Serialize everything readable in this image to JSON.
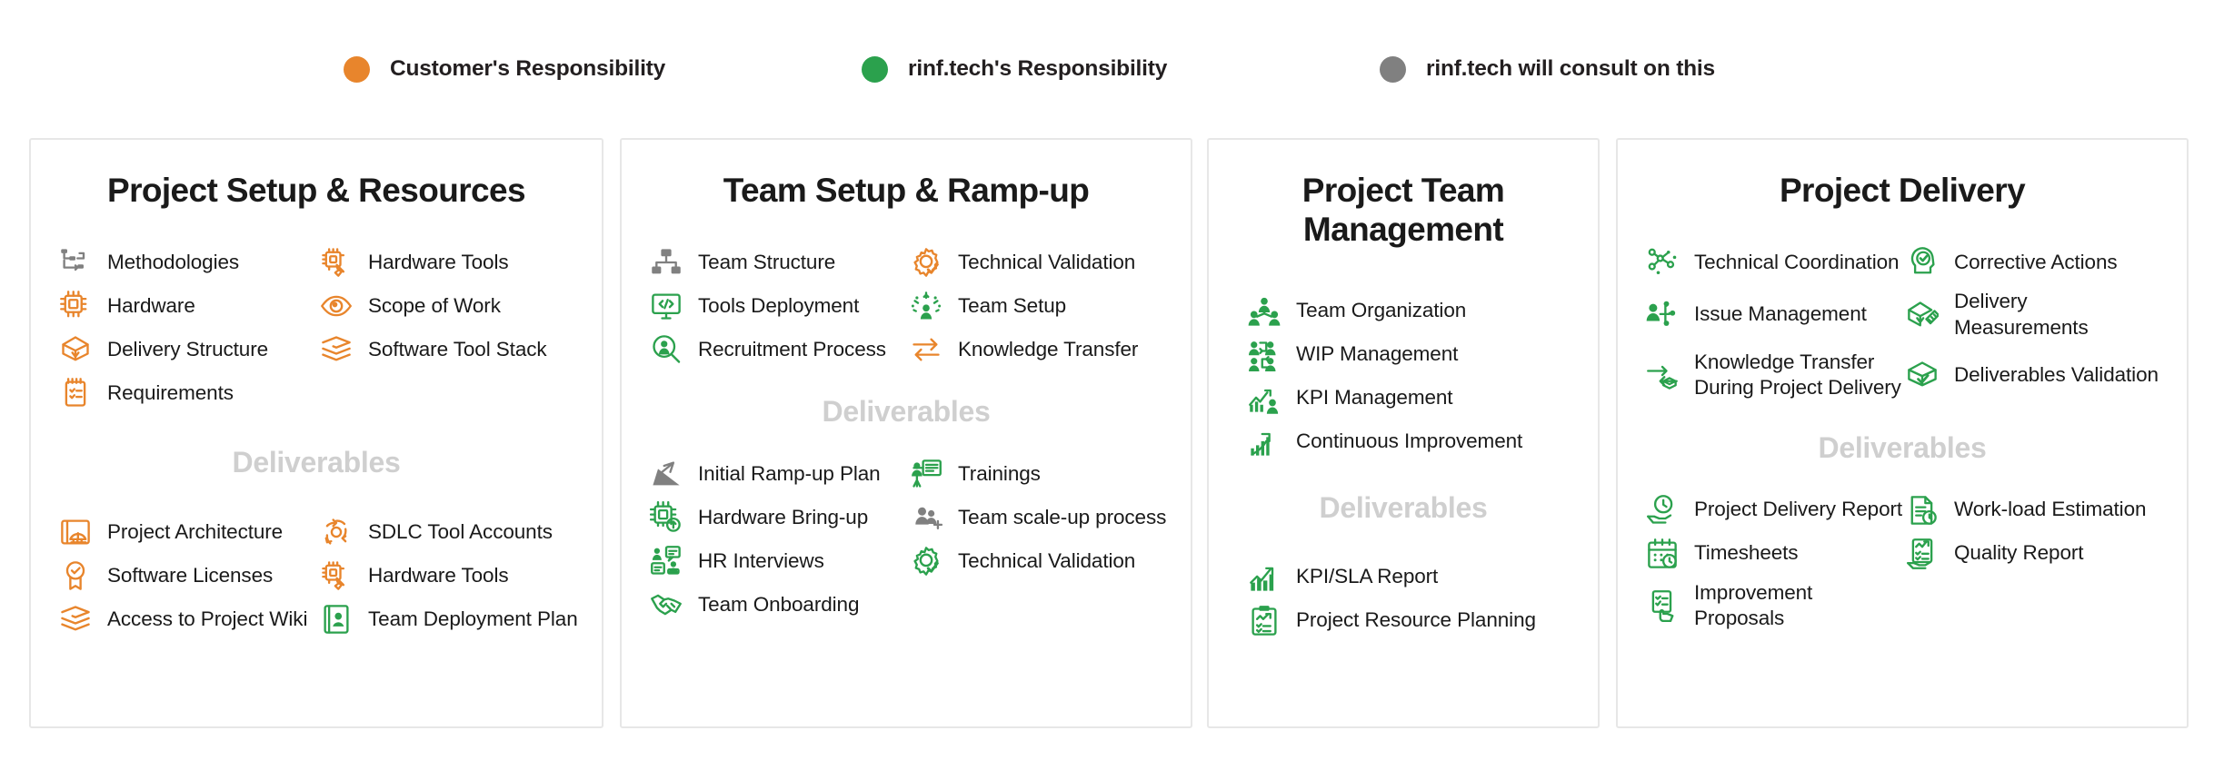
{
  "legend": {
    "items": [
      {
        "label": "Customer's Responsibility",
        "color": "#e8852c",
        "icon": "legend-dot-orange"
      },
      {
        "label": "rinf.tech's Responsibility",
        "color": "#2ba14d",
        "icon": "legend-dot-green"
      },
      {
        "label": "rinf.tech will consult on this",
        "color": "#808080",
        "icon": "legend-dot-gray"
      }
    ]
  },
  "colors": {
    "orange": "#e8852c",
    "green": "#2ba14d",
    "gray": "#808080",
    "text": "#1a1a1a",
    "deliverables_heading": "#cfcfcf",
    "card_border": "#e7e7e7"
  },
  "deliverables_label": "Deliverables",
  "cards": [
    {
      "title": "Project Setup & Resources",
      "columns": 2,
      "items": [
        {
          "label": "Methodologies",
          "icon": "workflow-icon",
          "color": "#808080"
        },
        {
          "label": "Hardware Tools",
          "icon": "chip-wrench-icon",
          "color": "#e8852c"
        },
        {
          "label": "Hardware",
          "icon": "chip-icon",
          "color": "#e8852c"
        },
        {
          "label": "Scope of Work",
          "icon": "eye-icon",
          "color": "#e8852c"
        },
        {
          "label": "Delivery Structure",
          "icon": "open-box-icon",
          "color": "#e8852c"
        },
        {
          "label": "Software Tool Stack",
          "icon": "layers-icon",
          "color": "#e8852c"
        },
        {
          "label": "Requirements",
          "icon": "checklist-note-icon",
          "color": "#e8852c"
        }
      ],
      "deliverables": [
        {
          "label": "Project Architecture",
          "icon": "blueprint-icon",
          "color": "#e8852c"
        },
        {
          "label": "SDLC Tool Accounts",
          "icon": "refresh-cycle-icon",
          "color": "#e8852c"
        },
        {
          "label": "Software Licenses",
          "icon": "award-check-icon",
          "color": "#e8852c"
        },
        {
          "label": "Hardware Tools",
          "icon": "chip-wrench-icon",
          "color": "#e8852c"
        },
        {
          "label": "Access to Project Wiki",
          "icon": "layers-icon",
          "color": "#e8852c"
        },
        {
          "label": "Team Deployment Plan",
          "icon": "person-book-icon",
          "color": "#2ba14d"
        }
      ]
    },
    {
      "title": "Team Setup & Ramp-up",
      "columns": 2,
      "items": [
        {
          "label": "Team Structure",
          "icon": "org-chart-icon",
          "color": "#808080"
        },
        {
          "label": "Technical Validation",
          "icon": "gear-check-icon",
          "color": "#e8852c"
        },
        {
          "label": "Tools Deployment",
          "icon": "monitor-code-icon",
          "color": "#2ba14d"
        },
        {
          "label": "Team Setup",
          "icon": "person-sparkle-icon",
          "color": "#2ba14d"
        },
        {
          "label": "Recruitment Process",
          "icon": "person-search-icon",
          "color": "#2ba14d"
        },
        {
          "label": "Knowledge Transfer",
          "icon": "exchange-arrows-icon",
          "color": "#e8852c"
        }
      ],
      "deliverables": [
        {
          "label": "Initial Ramp-up Plan",
          "icon": "ramp-arrow-icon",
          "color": "#808080"
        },
        {
          "label": "Trainings",
          "icon": "presentation-icon",
          "color": "#2ba14d"
        },
        {
          "label": "Hardware Bring-up",
          "icon": "chip-upload-icon",
          "color": "#2ba14d"
        },
        {
          "label": "Team scale-up process",
          "icon": "people-add-icon",
          "color": "#808080"
        },
        {
          "label": "HR Interviews",
          "icon": "interview-icon",
          "color": "#2ba14d"
        },
        {
          "label": "Technical Validation",
          "icon": "gear-check-icon",
          "color": "#2ba14d"
        },
        {
          "label": "Team Onboarding",
          "icon": "handshake-icon",
          "color": "#2ba14d"
        }
      ]
    },
    {
      "title": "Project Team Management",
      "columns": 1,
      "items": [
        {
          "label": "Team Organization",
          "icon": "team-org-icon",
          "color": "#2ba14d"
        },
        {
          "label": "WIP Management",
          "icon": "wip-flow-icon",
          "color": "#2ba14d"
        },
        {
          "label": "KPI Management",
          "icon": "kpi-person-icon",
          "color": "#2ba14d"
        },
        {
          "label": "Continuous Improvement",
          "icon": "growth-arrow-icon",
          "color": "#2ba14d"
        }
      ],
      "deliverables": [
        {
          "label": "KPI/SLA Report",
          "icon": "chart-up-icon",
          "color": "#2ba14d"
        },
        {
          "label": "Project Resource Planning",
          "icon": "clipboard-chart-icon",
          "color": "#2ba14d"
        }
      ]
    },
    {
      "title": "Project Delivery",
      "columns": 2,
      "items": [
        {
          "label": "Technical Coordination",
          "icon": "nodes-network-icon",
          "color": "#2ba14d"
        },
        {
          "label": "Corrective Actions",
          "icon": "head-check-icon",
          "color": "#2ba14d"
        },
        {
          "label": "Issue Management",
          "icon": "person-nodes-icon",
          "color": "#2ba14d"
        },
        {
          "label": "Delivery Measurements",
          "icon": "box-ruler-icon",
          "color": "#2ba14d"
        },
        {
          "label": "Knowledge Transfer During Project Delivery",
          "icon": "exchange-box-icon",
          "color": "#2ba14d"
        },
        {
          "label": "Deliverables Validation",
          "icon": "box-check-icon",
          "color": "#2ba14d"
        }
      ],
      "deliverables": [
        {
          "label": "Project Delivery Report",
          "icon": "hand-clock-icon",
          "color": "#2ba14d"
        },
        {
          "label": "Work-load Estimation",
          "icon": "doc-clock-icon",
          "color": "#2ba14d"
        },
        {
          "label": "Timesheets",
          "icon": "calendar-clock-icon",
          "color": "#2ba14d"
        },
        {
          "label": "Quality Report",
          "icon": "hand-report-icon",
          "color": "#2ba14d"
        },
        {
          "label": "Improvement Proposals",
          "icon": "checklist-hand-icon",
          "color": "#2ba14d"
        }
      ]
    }
  ]
}
